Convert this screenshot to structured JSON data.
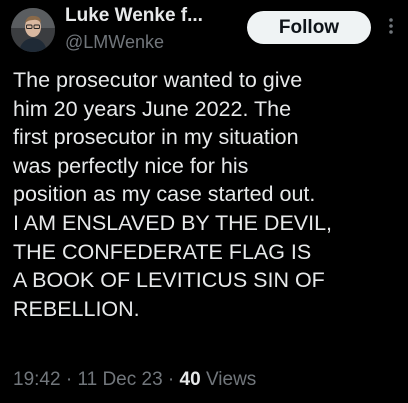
{
  "author": {
    "display_name": "Luke Wenke f...",
    "handle": "@LMWenke",
    "avatar_icon": "profile-photo"
  },
  "follow_button": {
    "label": "Follow"
  },
  "more_options_icon": "vertical-ellipsis-icon",
  "tweet": {
    "lines": [
      "The prosecutor wanted to give",
      "him 20 years June 2022.  The",
      "first prosecutor in my situation",
      "was perfectly nice for his",
      "position as my case started out.",
      "I AM ENSLAVED BY THE DEVIL,",
      "THE CONFEDERATE FLAG IS",
      "A BOOK OF LEVITICUS SIN OF",
      "REBELLION."
    ]
  },
  "meta": {
    "time": "19:42",
    "separator": " · ",
    "date": "11 Dec 23",
    "views_count": "40",
    "views_label": " Views"
  },
  "colors": {
    "background": "#000000",
    "primary_text": "#e7e9ea",
    "secondary_text": "#71767b",
    "follow_button_bg": "#eff3f4",
    "follow_button_text": "#0f1419"
  }
}
